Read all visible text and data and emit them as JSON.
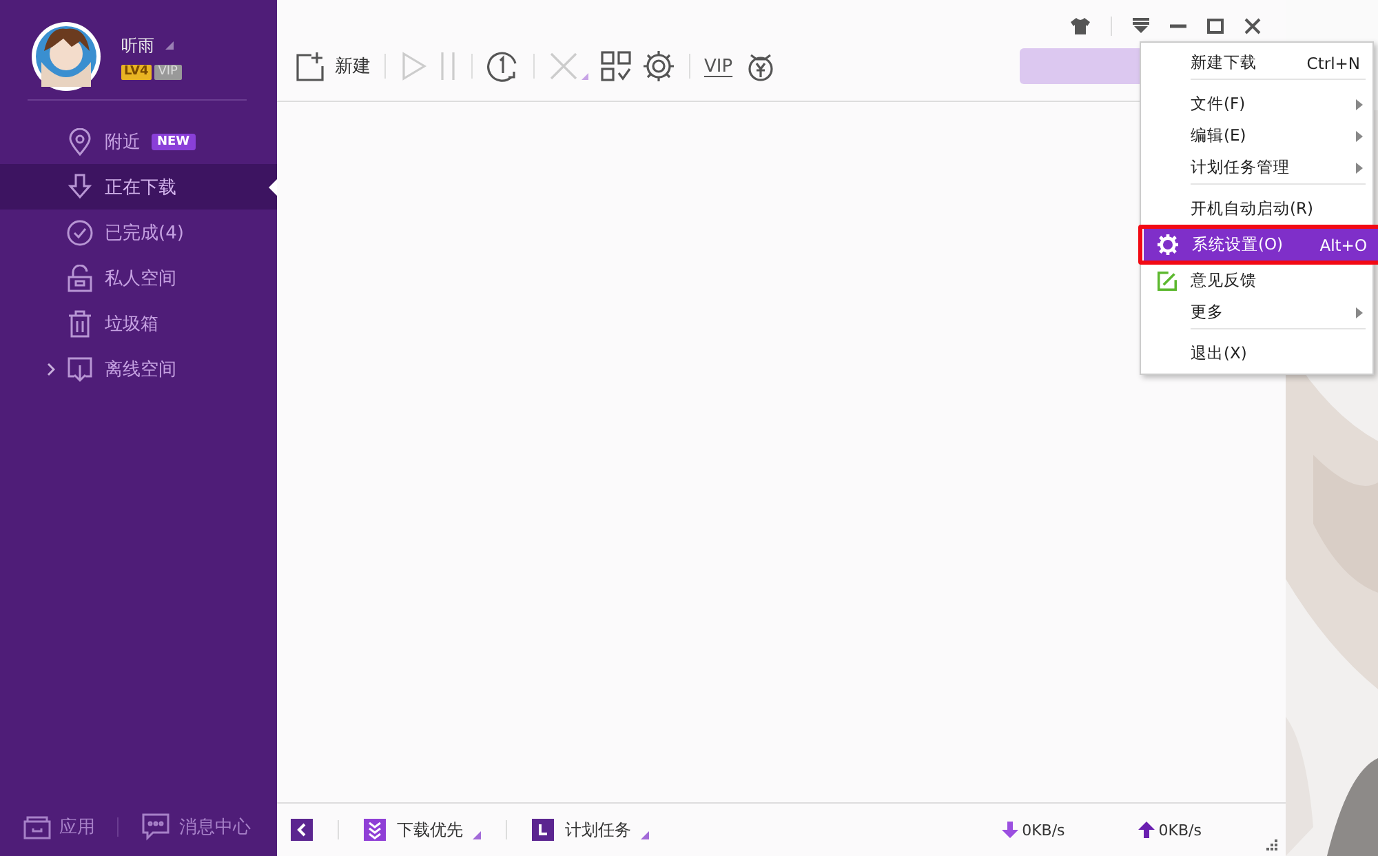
{
  "user": {
    "name": "听雨",
    "level": "LV4",
    "vip": "VIP"
  },
  "nav": [
    {
      "label": "附近",
      "kind": "pin",
      "badge": "NEW",
      "selected": false,
      "expandable": false
    },
    {
      "label": "正在下载",
      "kind": "download",
      "selected": true,
      "expandable": false
    },
    {
      "label": "已完成(4)",
      "kind": "check",
      "selected": false,
      "expandable": false
    },
    {
      "label": "私人空间",
      "kind": "lock",
      "selected": false,
      "expandable": false
    },
    {
      "label": "垃圾箱",
      "kind": "trash",
      "selected": false,
      "expandable": false
    },
    {
      "label": "离线空间",
      "kind": "cloud",
      "selected": false,
      "expandable": true
    }
  ],
  "sidebar_footer": [
    {
      "label": "应用",
      "kind": "apps"
    },
    {
      "label": "消息中心",
      "kind": "chat"
    }
  ],
  "toolbar": [
    {
      "kind": "new",
      "label": "新建",
      "disabled": false
    },
    {
      "kind": "play",
      "disabled": true
    },
    {
      "kind": "pause",
      "disabled": true
    },
    {
      "kind": "limit",
      "disabled": false
    },
    {
      "kind": "delete",
      "disabled": true
    },
    {
      "kind": "grid",
      "disabled": false
    },
    {
      "kind": "gear",
      "disabled": false
    },
    {
      "kind": "vip",
      "label": "VIP",
      "disabled": false
    },
    {
      "kind": "money",
      "disabled": false
    }
  ],
  "menu": [
    {
      "label": "新建下载",
      "shortcut": "Ctrl+N",
      "submenu": false,
      "selected": false,
      "separator_above": false,
      "highlighted": false
    },
    {
      "label": "文件(F)",
      "submenu": true,
      "selected": false,
      "separator_above": true,
      "highlighted": false
    },
    {
      "label": "编辑(E)",
      "submenu": true,
      "selected": false,
      "separator_above": false,
      "highlighted": false
    },
    {
      "label": "计划任务管理",
      "submenu": true,
      "selected": false,
      "separator_above": false,
      "highlighted": false
    },
    {
      "label": "开机自动启动(R)",
      "submenu": false,
      "selected": false,
      "separator_above": true,
      "highlighted": false
    },
    {
      "label": "系统设置(O)",
      "shortcut": "Alt+O",
      "kind": "gear",
      "submenu": false,
      "selected": true,
      "separator_above": false,
      "highlighted": true
    },
    {
      "label": "意见反馈",
      "kind": "edit",
      "submenu": false,
      "selected": false,
      "separator_above": false,
      "highlighted": false
    },
    {
      "label": "更多",
      "submenu": true,
      "selected": false,
      "separator_above": false,
      "highlighted": false
    },
    {
      "label": "退出(X)",
      "submenu": false,
      "selected": false,
      "separator_above": true,
      "highlighted": false
    }
  ],
  "status_bar": {
    "priority": "下载优先",
    "schedule": "计划任务",
    "download_speed": "0KB/s",
    "upload_speed": "0KB/s"
  }
}
